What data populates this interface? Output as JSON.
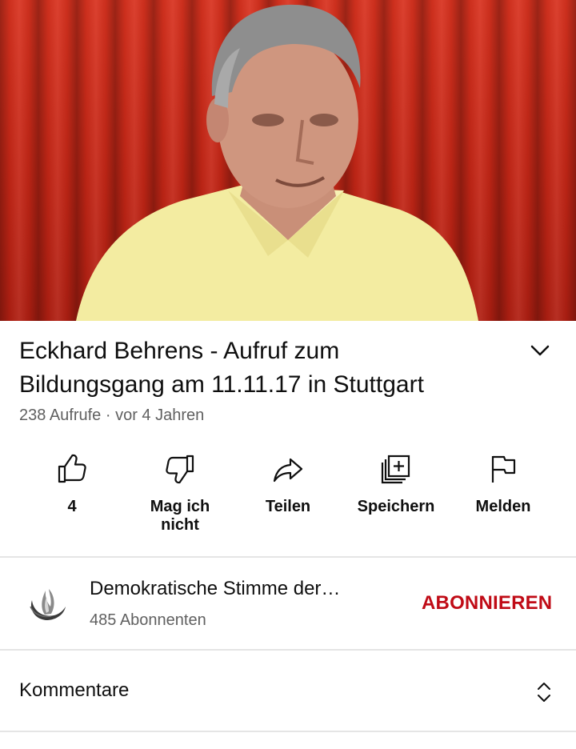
{
  "video": {
    "thumbnail_description_icon": "video-player"
  },
  "title": {
    "line1": "Eckhard Behrens - Aufruf zum",
    "line2": "Bildungsgang am 11.11.17 in Stuttgart",
    "expand_icon": "chevron-down-icon"
  },
  "meta": {
    "views": "238 Aufrufe",
    "separator": " · ",
    "age": "vor 4 Jahren"
  },
  "actions": {
    "like": {
      "label": "4",
      "icon": "thumbs-up-icon"
    },
    "dislike": {
      "label_line1": "Mag ich",
      "label_line2": "nicht",
      "icon": "thumbs-down-icon"
    },
    "share": {
      "label": "Teilen",
      "icon": "share-icon"
    },
    "save": {
      "label": "Speichern",
      "icon": "add-to-playlist-icon"
    },
    "report": {
      "label": "Melden",
      "icon": "flag-icon"
    }
  },
  "channel": {
    "name": "Demokratische Stimme der…",
    "subscribers": "485 Abonnenten",
    "subscribe_label": "ABONNIEREN",
    "subscribe_color": "#c00b16"
  },
  "comments": {
    "label": "Kommentare",
    "toggle_icon": "expand-collapse-icon"
  }
}
